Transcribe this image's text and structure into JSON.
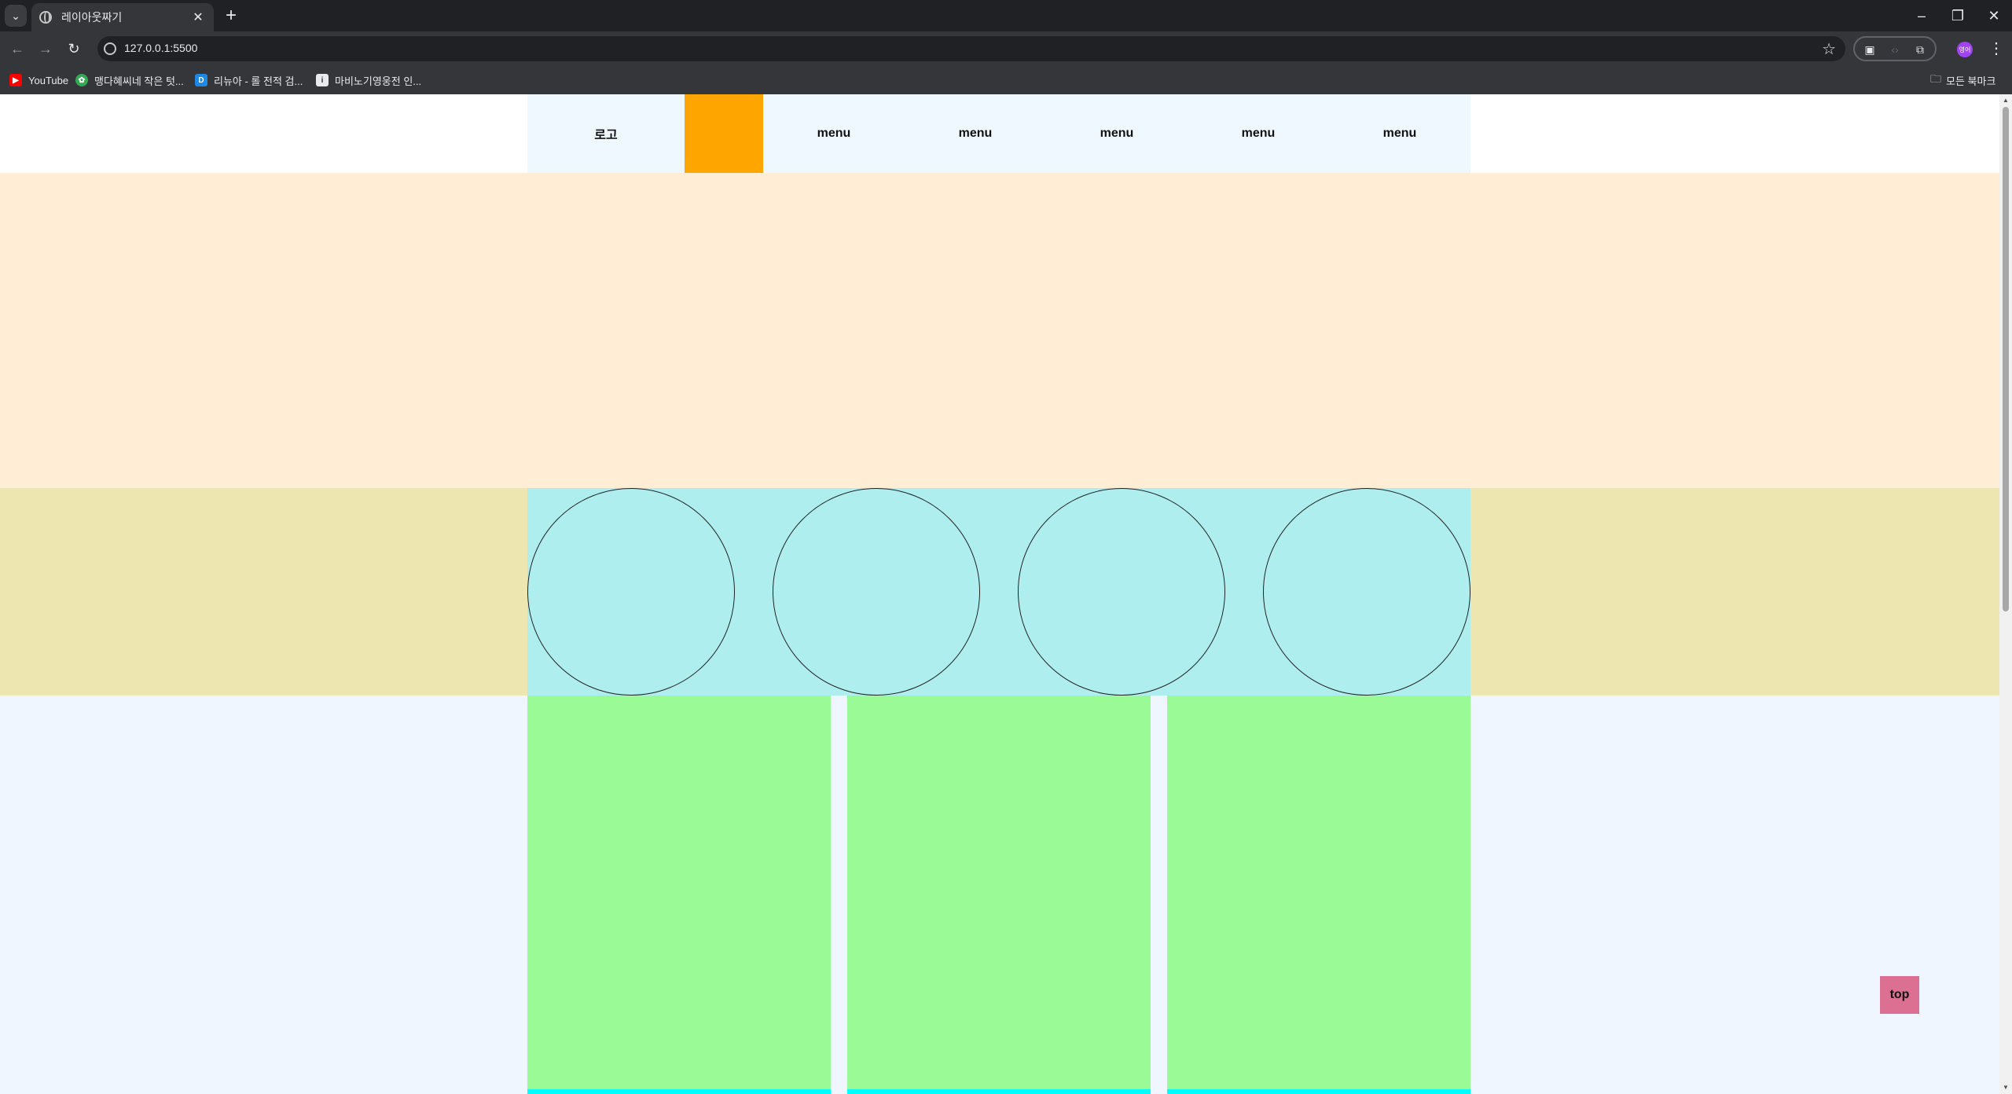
{
  "browser": {
    "tab_title": "레이아웃짜기",
    "url": "127.0.0.1:5500",
    "bookmarks": [
      {
        "label": "YouTube",
        "icon": "youtube-icon",
        "color": "#ff0000"
      },
      {
        "label": "맹다혜씨네 작은 텃...",
        "icon": "leaf-icon",
        "color": "#34a853"
      },
      {
        "label": "리뉴아 - 롤 전적 검...",
        "icon": "d-letter-icon",
        "color": "#1e88e5"
      },
      {
        "label": "마비노기영웅전 인...",
        "icon": "m-letter-icon",
        "color": "#6d6d6d"
      }
    ],
    "all_bookmarks": "모든 북마크",
    "profile_initials": "영어"
  },
  "page": {
    "header": {
      "logo": "로고",
      "menus": [
        "menu",
        "menu",
        "menu",
        "menu",
        "menu"
      ]
    },
    "top_button": "top"
  },
  "colors": {
    "header_bg": "#f0f8ff",
    "accent_orange": "#ffa500",
    "banner_bg": "#ffedd5",
    "circle_row_bg": "#ede6b0",
    "circle_inner_bg": "#afeeee",
    "card_bg": "#9afa96",
    "card_border": "#00ffff",
    "top_button_bg": "#db7093"
  }
}
